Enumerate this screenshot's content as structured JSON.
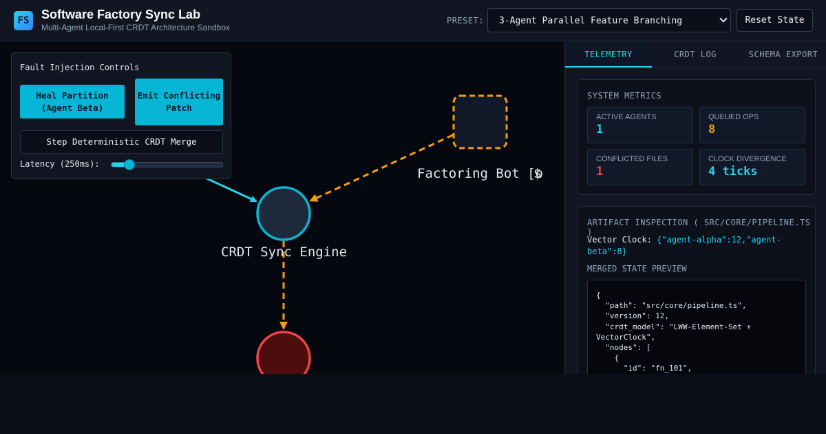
{
  "header": {
    "logo": "FS",
    "title": "Software Factory Sync Lab",
    "subtitle": "Multi-Agent Local-First CRDT Architecture Sandbox",
    "preset_label": "PRESET:",
    "preset_value": "3-Agent Parallel Feature Branching",
    "reset_label": "Reset State"
  },
  "fault_panel": {
    "title": "Fault Injection Controls",
    "heal_label": "Heal Partition (Agent Beta)",
    "emit_label": "Emit Conflicting Patch",
    "step_label": "Step Deterministic CRDT Merge",
    "latency_label": "Latency (250ms):",
    "latency_fraction": 0.16
  },
  "graph": {
    "node_labels": {
      "sync_engine": "CRDT Sync Engine",
      "refactor_bot": "Factoring Bot [o",
      "partial_left": "[",
      "partial_right": "$"
    },
    "colors": {
      "cyan": "#22d3ee",
      "orange": "#f59e0b",
      "red": "#ef4444",
      "node_fill": "#1e293b"
    }
  },
  "tabs": [
    {
      "label": "TELEMETRY",
      "active": true
    },
    {
      "label": "CRDT LOG",
      "active": false
    },
    {
      "label": "SCHEMA EXPORT",
      "active": false
    }
  ],
  "metrics": {
    "title": "SYSTEM METRICS",
    "items": [
      {
        "label": "ACTIVE AGENTS",
        "value": "1",
        "color": "#22d3ee"
      },
      {
        "label": "QUEUED OPS",
        "value": "8",
        "color": "#f59e0b"
      },
      {
        "label": "CONFLICTED FILES",
        "value": "1",
        "color": "#ef4444"
      },
      {
        "label": "CLOCK DIVERGENCE",
        "value": "4 ticks",
        "color": "#22d3ee"
      }
    ]
  },
  "artifact": {
    "title": "ARTIFACT INSPECTION ( SRC/CORE/PIPELINE.TS )",
    "vector_clock_label": "Vector Clock:",
    "vector_clock_value": "{\"agent-alpha\":12,\"agent-beta\":8}",
    "merged_title": "MERGED STATE PREVIEW",
    "code": "{\n  \"path\": \"src/core/pipeline.ts\",\n  \"version\": 12,\n  \"crdt_model\": \"LWW-Element-Set +\nVectorClock\",\n  \"nodes\": [\n    {\n      \"id\": \"fn_101\","
  }
}
